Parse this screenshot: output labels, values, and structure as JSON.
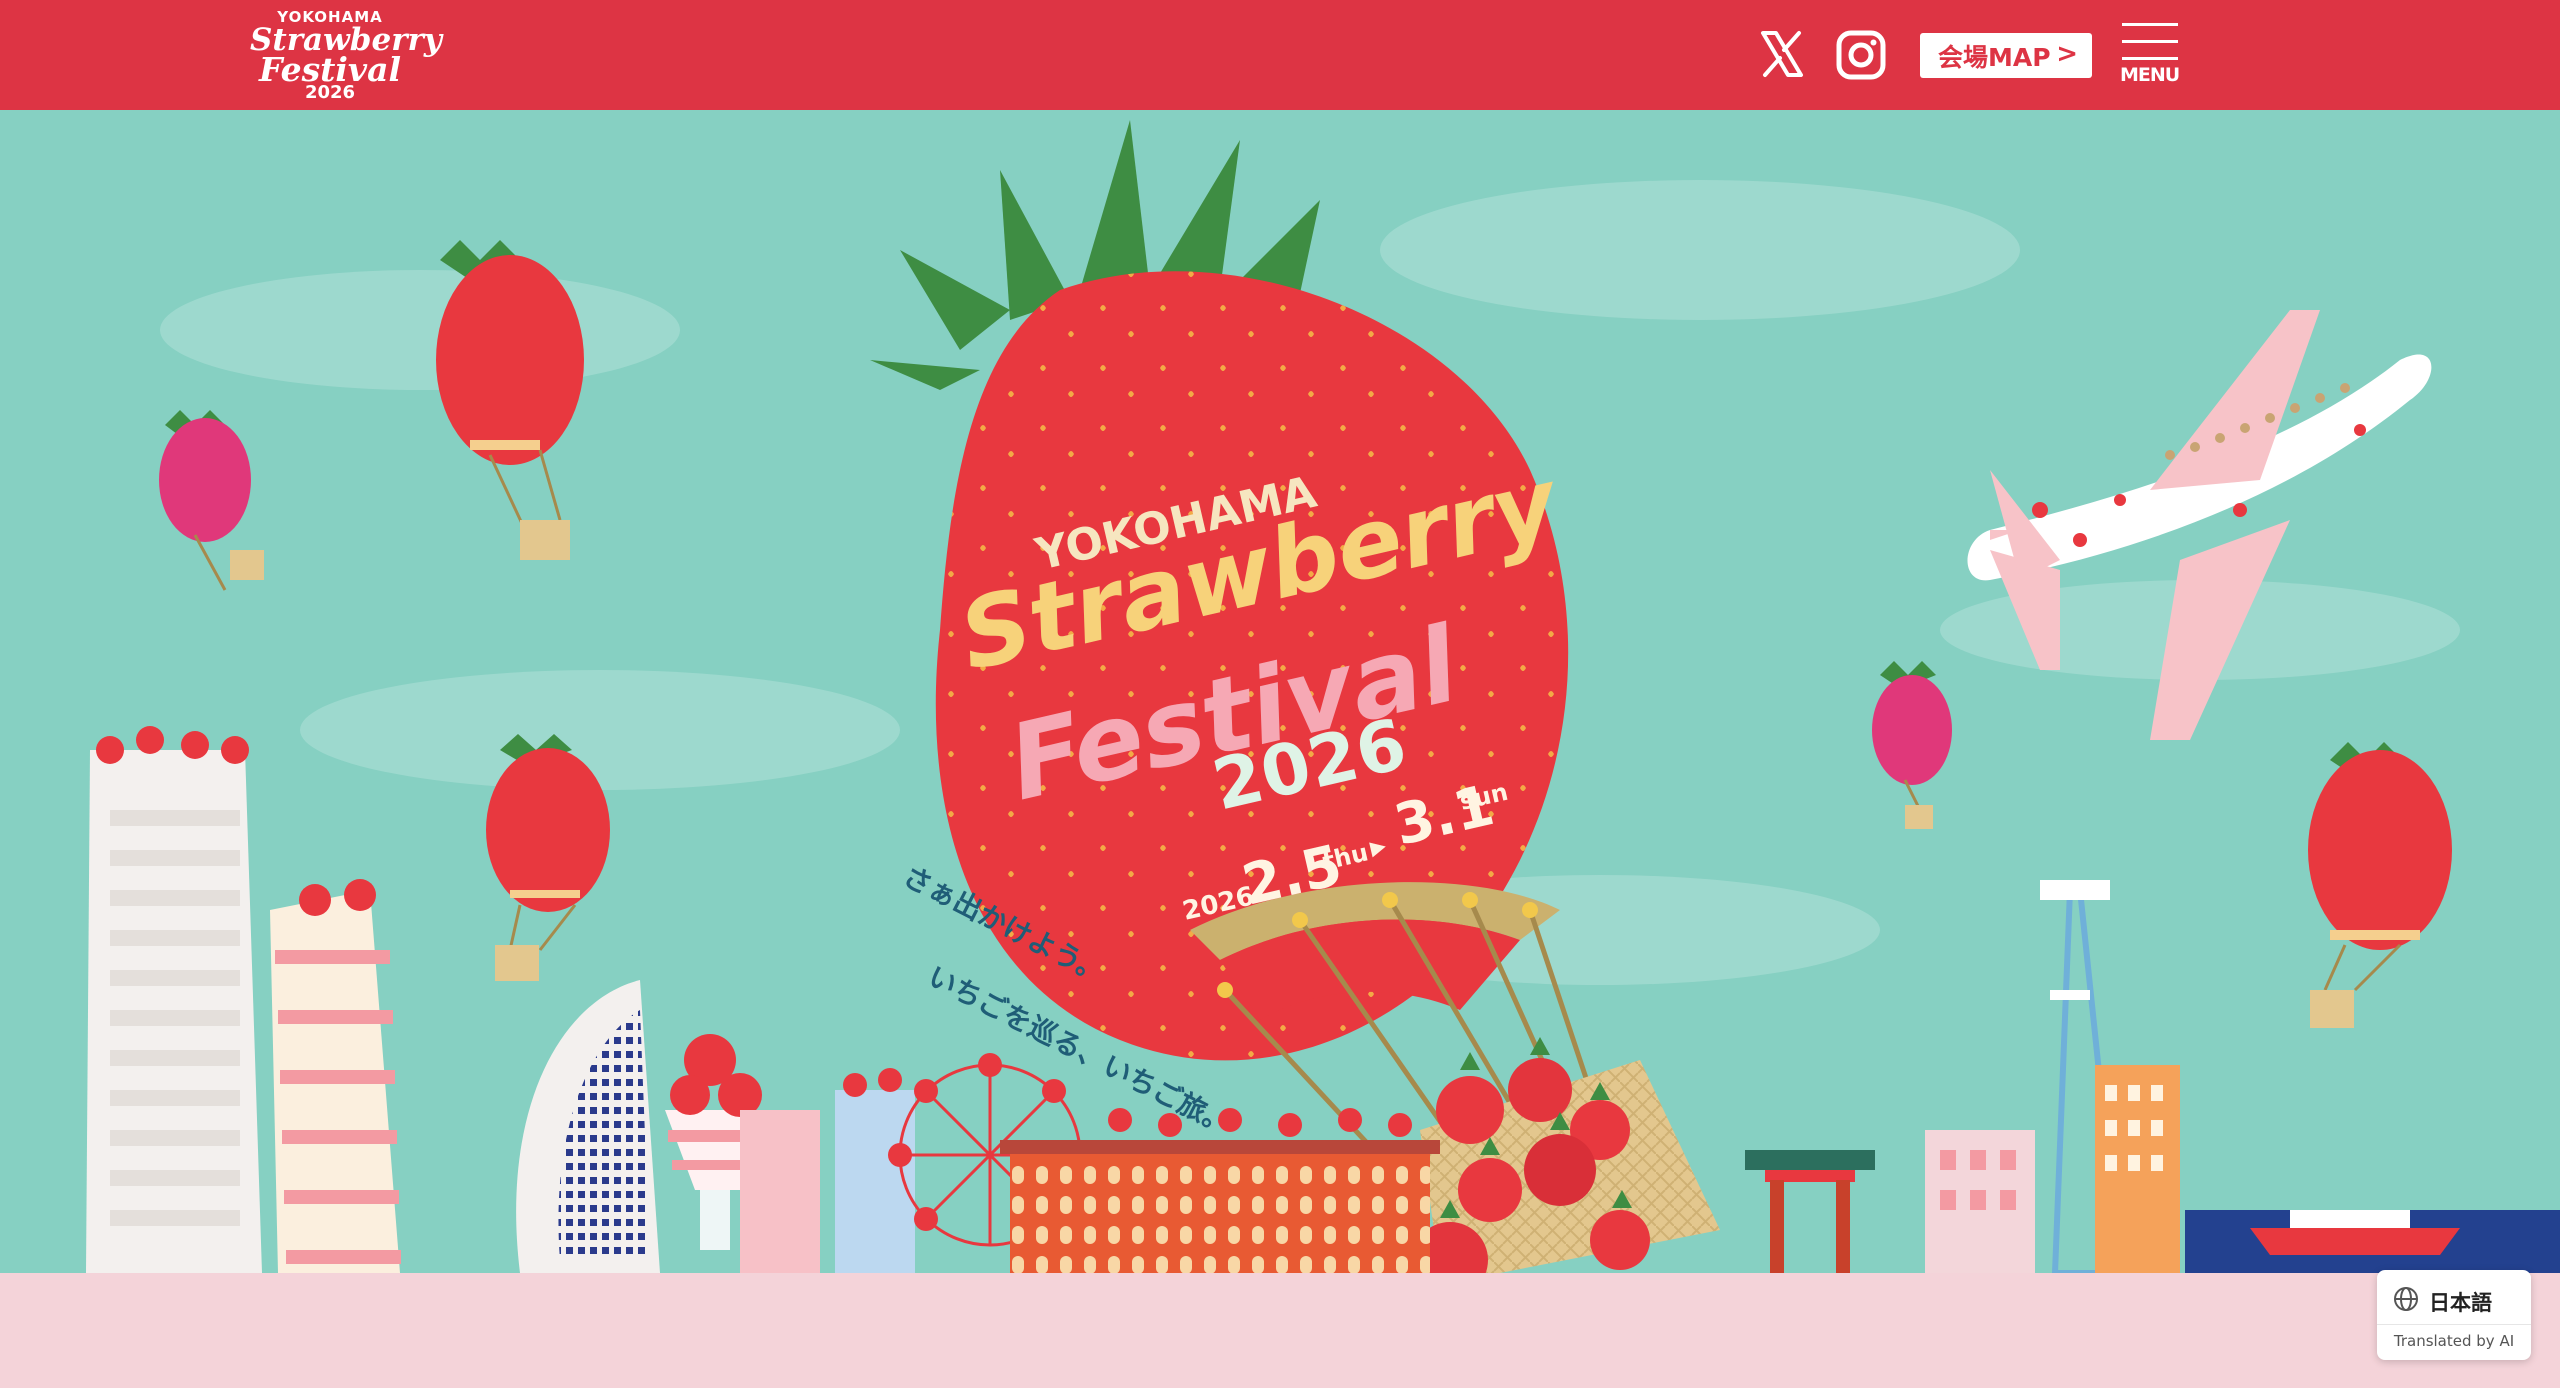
{
  "header": {
    "logo": {
      "line1": "YOKOHAMA",
      "line2": "Strawberry",
      "line3": "Festival",
      "line4": "2026"
    },
    "social": [
      {
        "icon": "x-icon"
      },
      {
        "icon": "instagram-icon"
      }
    ],
    "map_button": {
      "label": "会場MAP",
      "chevron": ">"
    },
    "menu_button": {
      "label": "MENU",
      "icon": "hamburger-icon"
    }
  },
  "hero": {
    "title": {
      "line1": "YOKOHAMA",
      "line2": "Strawberry",
      "line3": "Festival",
      "line4": "2026"
    },
    "dates": {
      "year": "2026",
      "start": "2.5",
      "start_day": "thu",
      "separator": "▶",
      "end": "3.1",
      "end_day": "sun"
    },
    "tagline": {
      "line1": "さぁ出かけよう。",
      "line2": "いちごを巡る、いちご旅。"
    }
  },
  "translate_widget": {
    "language": "日本語",
    "note": "Translated by AI"
  },
  "colors": {
    "header": "#dd3444",
    "sky": "#86d0c2",
    "bottom": "#f4d3d9",
    "strawberry": "#e8383f",
    "leaf": "#3e8d43"
  }
}
